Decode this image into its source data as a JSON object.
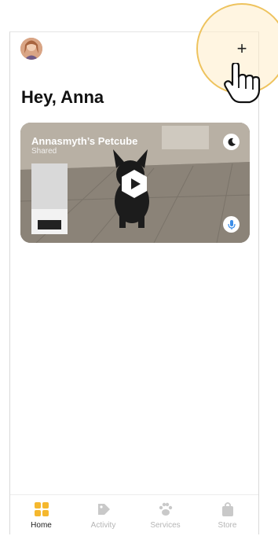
{
  "header": {
    "add_label": "+",
    "avatar_icon": "user-avatar"
  },
  "greeting": "Hey, Anna",
  "camera": {
    "name": "Annasmyth’s Petcube",
    "status": "Shared",
    "night_icon": "moon-icon",
    "mic_icon": "microphone-icon",
    "play_icon": "play-icon"
  },
  "tabs": [
    {
      "label": "Home",
      "icon": "home-grid-icon",
      "active": true
    },
    {
      "label": "Activity",
      "icon": "activity-tag-icon",
      "active": false
    },
    {
      "label": "Services",
      "icon": "paw-icon",
      "active": false
    },
    {
      "label": "Store",
      "icon": "shopping-bag-icon",
      "active": false
    }
  ],
  "colors": {
    "accent": "#f5b82e",
    "highlight_ring": "#eec35e",
    "mic_blue": "#3b8de8",
    "inactive_tab": "#b5b5b5"
  }
}
